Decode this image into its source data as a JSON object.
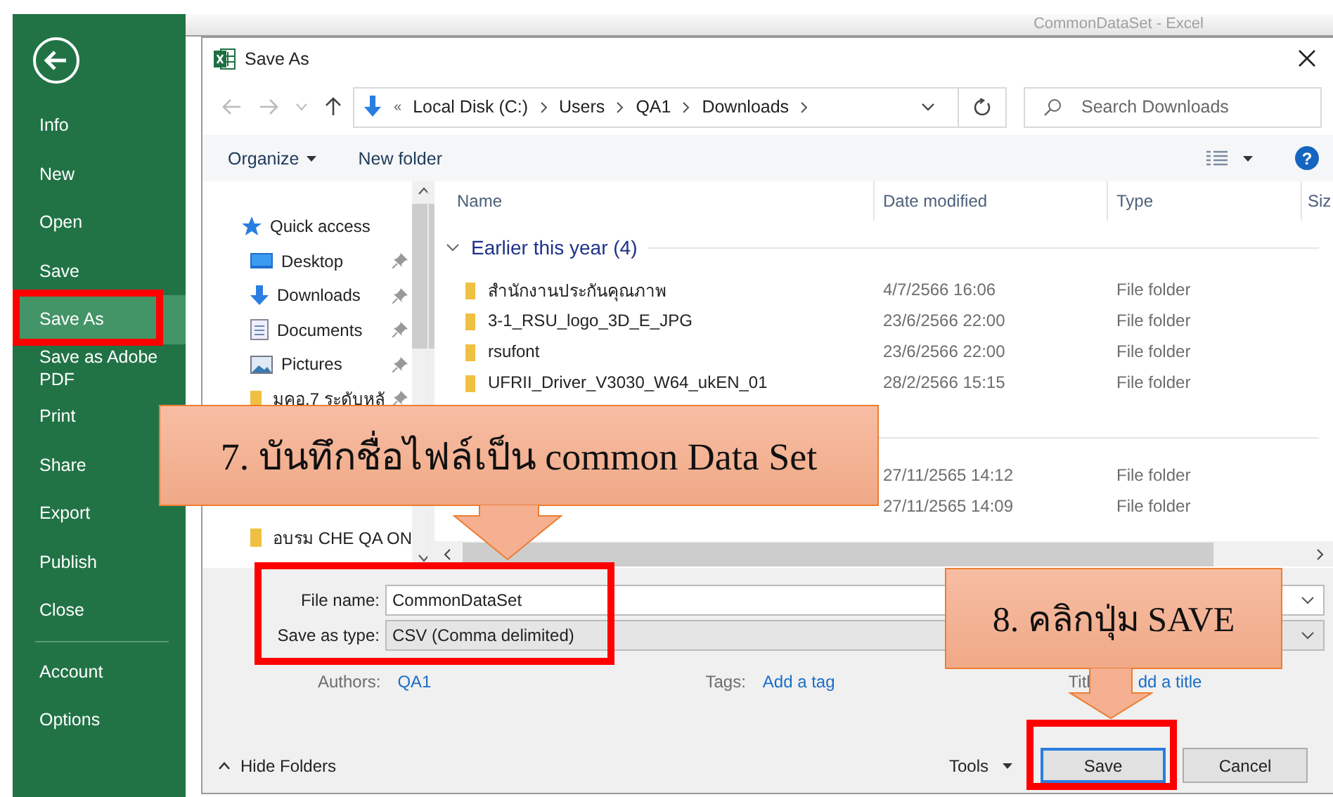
{
  "excel_title": "CommonDataSet - Excel",
  "backstage": {
    "items": [
      {
        "label": "Info",
        "selected": false
      },
      {
        "label": "New",
        "selected": false
      },
      {
        "label": "Open",
        "selected": false
      },
      {
        "label": "Save",
        "selected": false
      },
      {
        "label": "Save As",
        "selected": true
      },
      {
        "label": "Save as Adobe PDF",
        "selected": false
      },
      {
        "label": "Print",
        "selected": false
      },
      {
        "label": "Share",
        "selected": false
      },
      {
        "label": "Export",
        "selected": false
      },
      {
        "label": "Publish",
        "selected": false
      },
      {
        "label": "Close",
        "selected": false
      }
    ],
    "footer_items": [
      {
        "label": "Account",
        "selected": false
      },
      {
        "label": "Options",
        "selected": false
      }
    ]
  },
  "dialog": {
    "title": "Save As",
    "address_overflow": "«",
    "address": [
      "Local Disk (C:)",
      "Users",
      "QA1",
      "Downloads"
    ],
    "help": "?",
    "search": {
      "placeholder": "Search Downloads"
    },
    "toolbar": {
      "organize": "Organize",
      "new_folder": "New folder"
    },
    "nav_pane": {
      "header": "Quick access",
      "items": [
        {
          "label": "Desktop",
          "kind": "desktop",
          "pinned": true
        },
        {
          "label": "Downloads",
          "kind": "download",
          "pinned": true
        },
        {
          "label": "Documents",
          "kind": "documents",
          "pinned": true
        },
        {
          "label": "Pictures",
          "kind": "pictures",
          "pinned": true
        },
        {
          "label": "มคอ.7 ระดับหลั",
          "kind": "folder",
          "pinned": true
        },
        {
          "label": "อบรม CHE QA ON",
          "kind": "folder",
          "pinned": false
        }
      ]
    },
    "columns": [
      "Name",
      "Date modified",
      "Type",
      "Siz"
    ],
    "group": {
      "label": "Earlier this year (4)",
      "expanded": true,
      "rows": [
        {
          "name": "สำนักงานประกันคุณภาพ",
          "date": "4/7/2566 16:06",
          "type": "File folder"
        },
        {
          "name": "3-1_RSU_logo_3D_E_JPG",
          "date": "23/6/2566 22:00",
          "type": "File folder"
        },
        {
          "name": "rsufont",
          "date": "23/6/2566 22:00",
          "type": "File folder"
        },
        {
          "name": "UFRII_Driver_V3030_W64_ukEN_01",
          "date": "28/2/2566 15:15",
          "type": "File folder"
        }
      ]
    },
    "partial_rows": [
      {
        "date": "27/11/2565 14:12",
        "type": "File folder"
      },
      {
        "date": "27/11/2565 14:09",
        "type": "File folder"
      }
    ],
    "form": {
      "file_name_label": "File name:",
      "file_name": "CommonDataSet",
      "type_label": "Save as type:",
      "type": "CSV (Comma delimited)",
      "authors_label": "Authors:",
      "authors": "QA1",
      "tags_label": "Tags:",
      "tags_placeholder": "Add a tag",
      "title_label": "Titl",
      "title_placeholder": "dd a title"
    },
    "footer": {
      "hide_folders": "Hide Folders",
      "tools": "Tools",
      "save": "Save",
      "cancel": "Cancel"
    }
  },
  "callouts": [
    {
      "text": "7. บันทึกชื่อไฟล์เป็น common Data Set"
    },
    {
      "text": "8. คลิกปุ่ม SAVE"
    }
  ]
}
